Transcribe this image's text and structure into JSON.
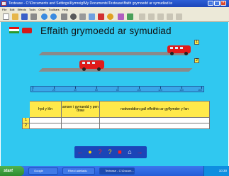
{
  "window": {
    "title": "Textease - C:\\Documents and Settings\\Kymreig\\My Documents\\Textease\\ffaith grymoedd ar symudiad.te",
    "minimize": "_",
    "maximize": "□",
    "close": "×"
  },
  "menu": [
    "File",
    "Edit",
    "Effects",
    "Tools",
    "Other",
    "Toolbars",
    "Help"
  ],
  "toolbar": {
    "icons": [
      "new-icon",
      "open-icon",
      "save-icon",
      "print-icon",
      "undo-icon",
      "redo-icon",
      "spell-check-icon",
      "find-icon",
      "cut-icon",
      "copy-icon",
      "delete-icon",
      "settings-icon",
      "paint-icon",
      "style-icon"
    ]
  },
  "page": {
    "heading": "Effaith grymoedd ar symudiad",
    "lane_labels": [
      "1",
      "2"
    ],
    "ruler": {
      "marks": [
        "0",
        "20",
        "40",
        "60",
        "80",
        "100",
        "120",
        "140",
        "160"
      ]
    },
    "table": {
      "headers": [
        "hyd y lôn",
        "amser i gyrraedd y pen draw",
        "nodweddion gall effeithio ar gyflymder y fan"
      ],
      "rows": [
        {
          "num": "1",
          "cells": [
            "",
            "",
            ""
          ]
        },
        {
          "num": "2",
          "cells": [
            "",
            "",
            ""
          ]
        }
      ]
    },
    "nav": {
      "buttons": [
        "←",
        "●",
        "?",
        "?",
        "■",
        "⌂",
        "→"
      ],
      "colors": [
        "#e8102a",
        "#ffd200",
        "#ff2020",
        "#ffd200",
        "#ff2020",
        "#ffffff",
        "#e8102a"
      ]
    }
  },
  "taskbar": {
    "start": "start",
    "tasks": [
      "Google",
      "Rheol adeiladu",
      "Textease - C:\\Docum..."
    ],
    "clock": "10:30"
  },
  "colors": {
    "canvas": "#30c8f0",
    "heading": "#111111",
    "table_header": "#ffe94a",
    "bus": "#e11b1b",
    "navbar": "#1b45b8"
  }
}
